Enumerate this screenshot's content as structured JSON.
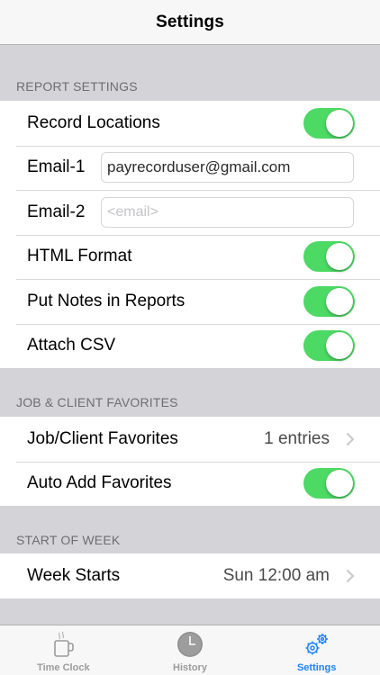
{
  "navbar": {
    "title": "Settings"
  },
  "report_settings": {
    "header": "REPORT SETTINGS",
    "record_locations": {
      "label": "Record Locations",
      "on": true
    },
    "email1": {
      "label": "Email-1",
      "value": "payrecorduser@gmail.com"
    },
    "email2": {
      "label": "Email-2",
      "placeholder": "<email>"
    },
    "html_format": {
      "label": "HTML Format",
      "on": true
    },
    "notes_in_reports": {
      "label": "Put Notes in Reports",
      "on": true
    },
    "attach_csv": {
      "label": "Attach CSV",
      "on": true
    }
  },
  "favorites": {
    "header": "JOB & CLIENT FAVORITES",
    "job_client": {
      "label": "Job/Client Favorites",
      "value": "1 entries"
    },
    "auto_add": {
      "label": "Auto Add Favorites",
      "on": true
    }
  },
  "week": {
    "header": "START OF WEEK",
    "week_starts": {
      "label": "Week Starts",
      "value": "Sun 12:00 am"
    }
  },
  "tabbar": {
    "tabs": [
      {
        "label": "Time Clock",
        "icon": "coffee-cup-icon",
        "active": false
      },
      {
        "label": "History",
        "icon": "clock-icon",
        "active": false
      },
      {
        "label": "Settings",
        "icon": "gears-icon",
        "active": true
      }
    ]
  },
  "colors": {
    "switch_on": "#4cd964",
    "tint": "#1a82fb",
    "background": "#d4d4d8"
  }
}
